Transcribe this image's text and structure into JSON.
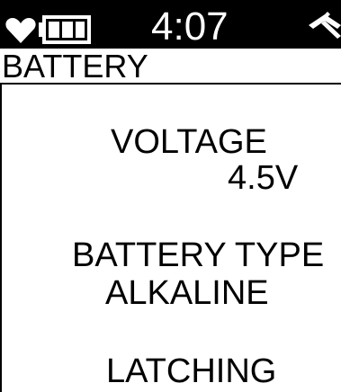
{
  "status_bar": {
    "time": "4:07",
    "icons": {
      "heart": "heart-icon",
      "battery": "battery-icon",
      "status": "signal-icon"
    }
  },
  "header": {
    "title": "BATTERY"
  },
  "main": {
    "voltage_label": "VOLTAGE",
    "voltage_value": "4.5V",
    "battery_type_label": "BATTERY TYPE",
    "battery_type_value": "ALKALINE",
    "latching_label": "LATCHING"
  },
  "colors": {
    "background": "#ffffff",
    "status_bar": "#000000",
    "text": "#000000"
  }
}
